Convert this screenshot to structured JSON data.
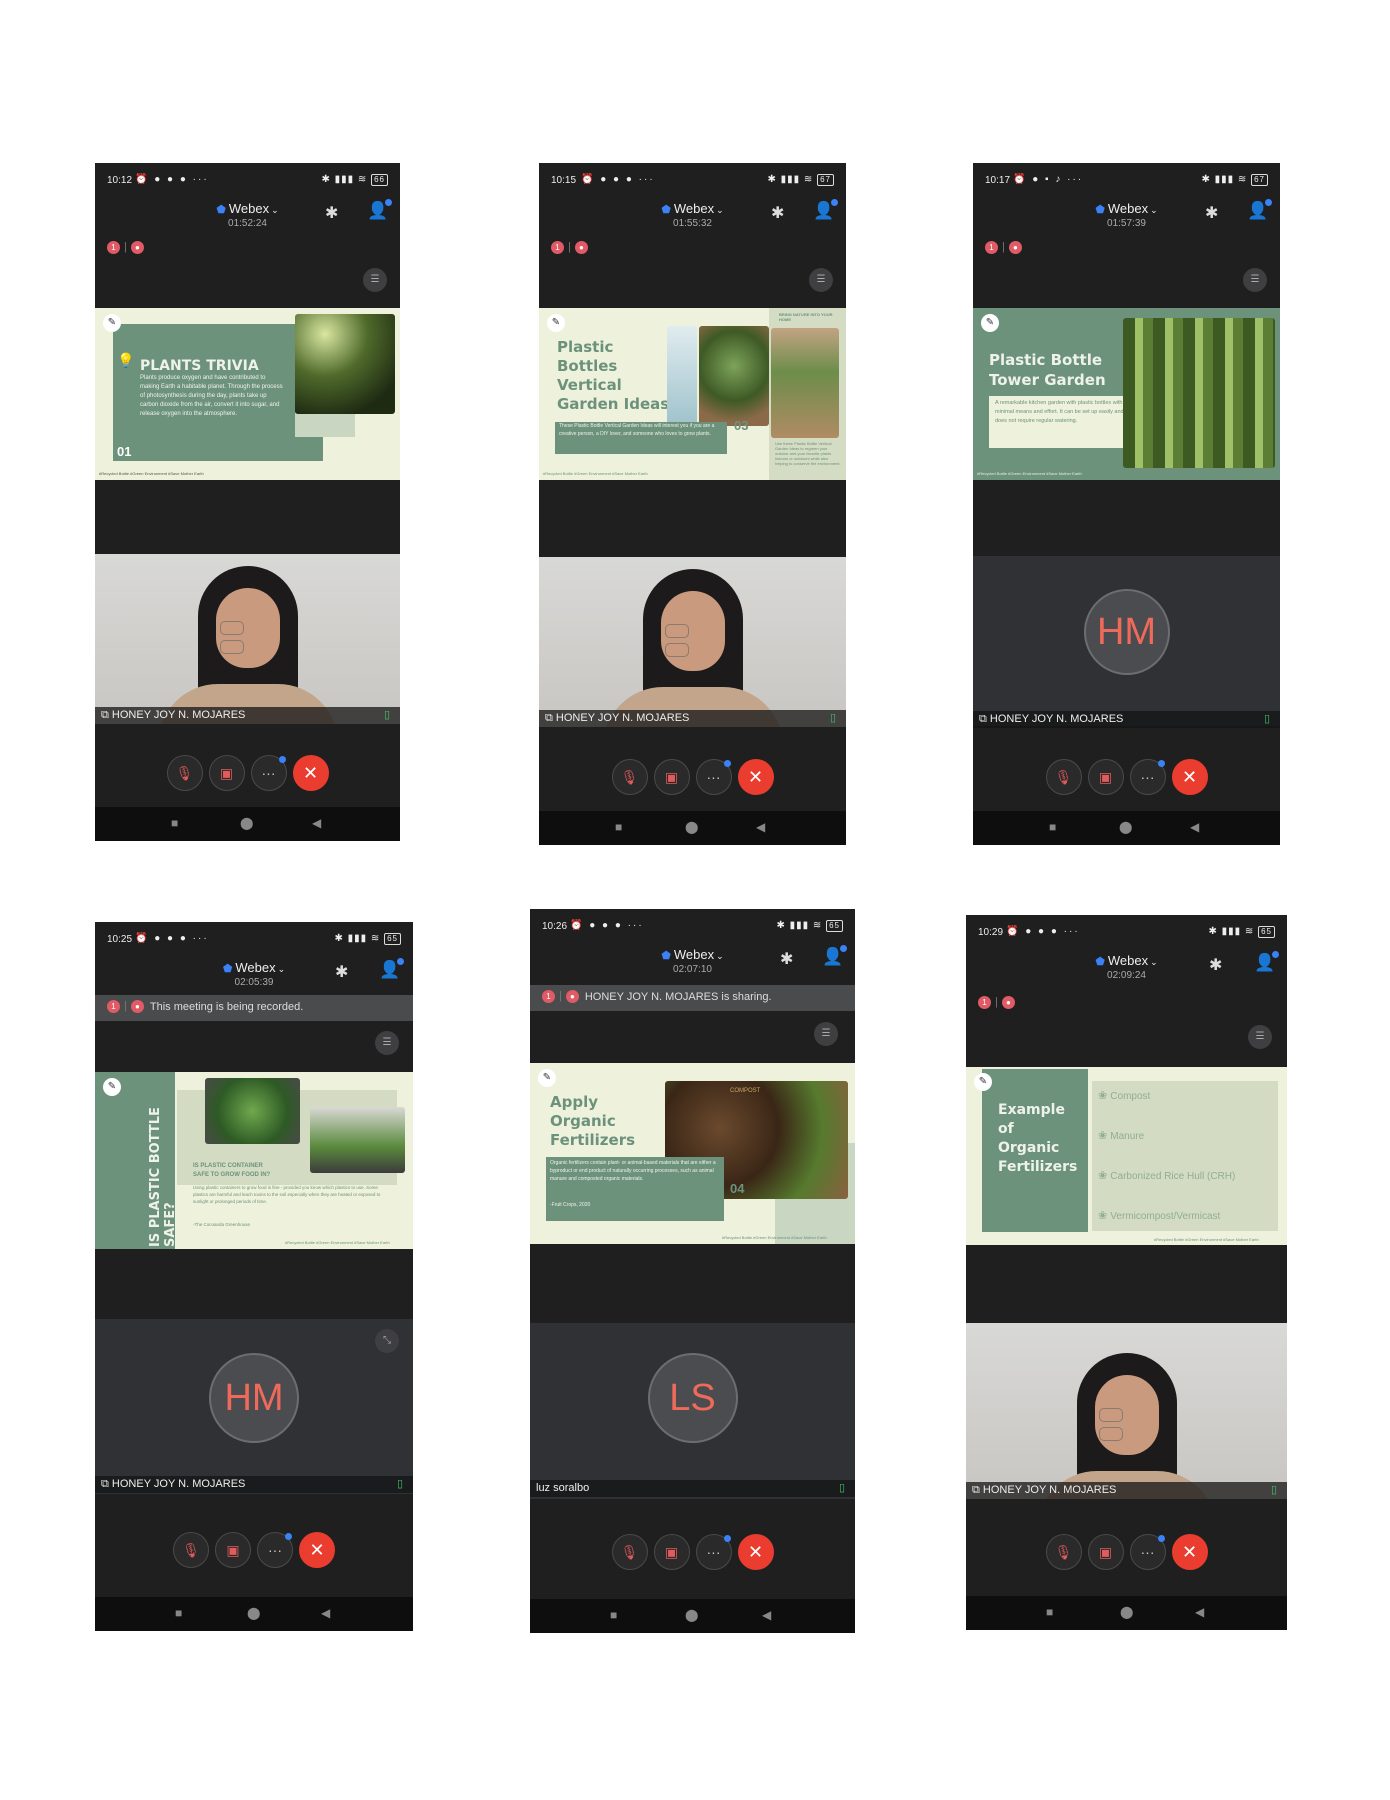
{
  "app": {
    "name": "Webex",
    "participant_name": "HONEY JOY N. MOJARES",
    "record_count": "1",
    "end_icon": "✕"
  },
  "phones": [
    {
      "time": "10:12",
      "battery": "66",
      "timer": "01:52:24"
    },
    {
      "time": "10:15",
      "battery": "67",
      "timer": "01:55:32"
    },
    {
      "time": "10:17",
      "battery": "67",
      "timer": "01:57:39",
      "avatar": "HM"
    },
    {
      "time": "10:25",
      "battery": "65",
      "timer": "02:05:39",
      "banner": "This meeting is being recorded.",
      "avatar": "HM"
    },
    {
      "time": "10:26",
      "battery": "65",
      "timer": "02:07:10",
      "banner": "HONEY JOY N. MOJARES is sharing.",
      "avatar": "LS",
      "name": "luz soralbo"
    },
    {
      "time": "10:29",
      "battery": "65",
      "timer": "02:09:24"
    }
  ],
  "slides": {
    "s1": {
      "title": "PLANTS TRIVIA",
      "num": "01",
      "body": "Plants produce oxygen and have contributed to making Earth a habitable planet. Through the process of photosynthesis during the day, plants take up carbon dioxide from the air, convert it into sugar, and release oxygen into the atmosphere.",
      "tags": "#Recycled Bottle #Green Environment #Save Mother Earth"
    },
    "s2": {
      "title_lines": [
        "Plastic",
        "Bottles",
        "Vertical",
        "Garden Ideas"
      ],
      "num": "03",
      "body": "These Plastic Bottle Vertical Garden Ideas will interest you if you are a creative person, a DIY lover, and someone who loves to grow plants.",
      "corner": "BRING NATURE INTO YOUR HOME",
      "side": "Use these Plastic Bottle Vertical Garden Ideas to regreen your outdoor and your favorite plants indoors or outdoors while also helping to conserve the environment.",
      "tags": "#Recycled Bottle #Green Environment #Save Mother Earth"
    },
    "s3": {
      "title_lines": [
        "Plastic Bottle",
        "Tower Garden"
      ],
      "body": "A remarkable kitchen garden with plastic bottles with minimal means and effort. It can be set up easily and does not require regular watering.",
      "tags": "#Recycled Bottle #Green Environment #Save Mother Earth"
    },
    "s4": {
      "vertical": "IS PLASTIC BOTTLE SAFE?",
      "heading_lines": [
        "IS PLASTIC CONTAINER",
        "SAFE TO GROW FOOD IN?"
      ],
      "body": "Using plastic containers to grow food is fine - provided you know which plastics to use. Some plastics are harmful and leach toxins to the soil especially when they are heated or exposed to sunlight or prolonged periods of time.",
      "credit": "-The Cocoanda Greenhouse",
      "tags": "#Recycled Bottle #Green Environment #Save Mother Earth"
    },
    "s5": {
      "title_lines": [
        "Apply",
        "Organic",
        "Fertilizers"
      ],
      "num": "04",
      "img_label": "COMPOST",
      "body": "Organic fertilizers contain plant- or animal-based materials that are either a byproduct or end product of naturally occurring processes, such as animal manure and composted organic materials.",
      "credit": "-Fruit Crops, 2020",
      "tags": "#Recycled Bottle #Green Environment #Save Mother Earth"
    },
    "s6": {
      "title_lines": [
        "Example",
        "of",
        "Organic",
        "Fertilizers"
      ],
      "items": [
        "Compost",
        "Manure",
        "Carbonized Rice Hull (CRH)",
        "Vermicompost/Vermicast"
      ],
      "tags": "#Recycled Bottle #Green Environment #Save Mother Earth"
    }
  },
  "colors": {
    "accent_green": "#6c927c",
    "slide_cream": "#eef1dc",
    "end_red": "#ea3d2f",
    "avatar_text": "#ef6a5a"
  }
}
